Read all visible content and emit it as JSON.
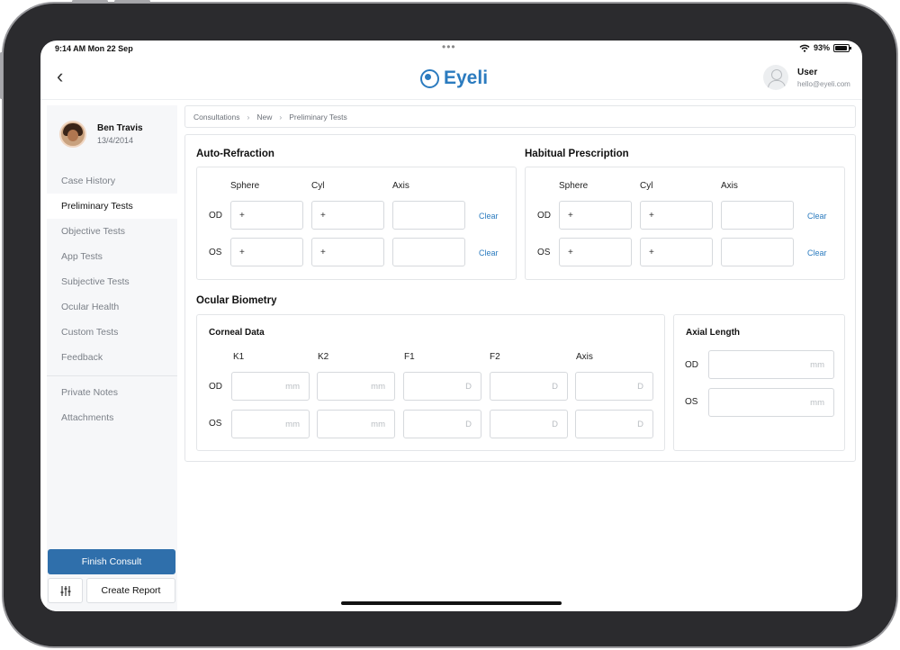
{
  "status_bar": {
    "time": "9:14 AM  Mon 22 Sep",
    "dots": "•••",
    "battery": "93%"
  },
  "header": {
    "brand": "Eyeli",
    "user_name": "User",
    "user_email": "hello@eyeli.com"
  },
  "patient": {
    "name": "Ben Travis",
    "dob": "13/4/2014"
  },
  "sidebar": {
    "items": [
      "Case History",
      "Preliminary Tests",
      "Objective Tests",
      "App Tests",
      "Subjective Tests",
      "Ocular Health",
      "Custom Tests",
      "Feedback"
    ],
    "secondary": [
      "Private Notes",
      "Attachments"
    ],
    "active": "Preliminary Tests",
    "finish_label": "Finish Consult",
    "create_label": "Create Report"
  },
  "breadcrumb": [
    "Consultations",
    "New",
    "Preliminary Tests"
  ],
  "auto_refraction": {
    "title": "Auto-Refraction",
    "columns": [
      "Sphere",
      "Cyl",
      "Axis"
    ],
    "rows": [
      {
        "label": "OD",
        "values": [
          "+",
          "+",
          ""
        ],
        "clear": "Clear"
      },
      {
        "label": "OS",
        "values": [
          "+",
          "+",
          ""
        ],
        "clear": "Clear"
      }
    ]
  },
  "habitual_prescription": {
    "title": "Habitual Prescription",
    "columns": [
      "Sphere",
      "Cyl",
      "Axis"
    ],
    "rows": [
      {
        "label": "OD",
        "values": [
          "+",
          "+",
          ""
        ],
        "clear": "Clear"
      },
      {
        "label": "OS",
        "values": [
          "+",
          "+",
          ""
        ],
        "clear": "Clear"
      }
    ]
  },
  "ocular_biometry": {
    "title": "Ocular Biometry",
    "corneal": {
      "title": "Corneal Data",
      "columns": [
        "K1",
        "K2",
        "F1",
        "F2",
        "Axis"
      ],
      "rows": [
        {
          "label": "OD",
          "placeholders": [
            "mm",
            "mm",
            "D",
            "D",
            "D"
          ]
        },
        {
          "label": "OS",
          "placeholders": [
            "mm",
            "mm",
            "D",
            "D",
            "D"
          ]
        }
      ]
    },
    "axial": {
      "title": "Axial Length",
      "rows": [
        {
          "label": "OD",
          "placeholder": "mm"
        },
        {
          "label": "OS",
          "placeholder": "mm"
        }
      ]
    }
  }
}
